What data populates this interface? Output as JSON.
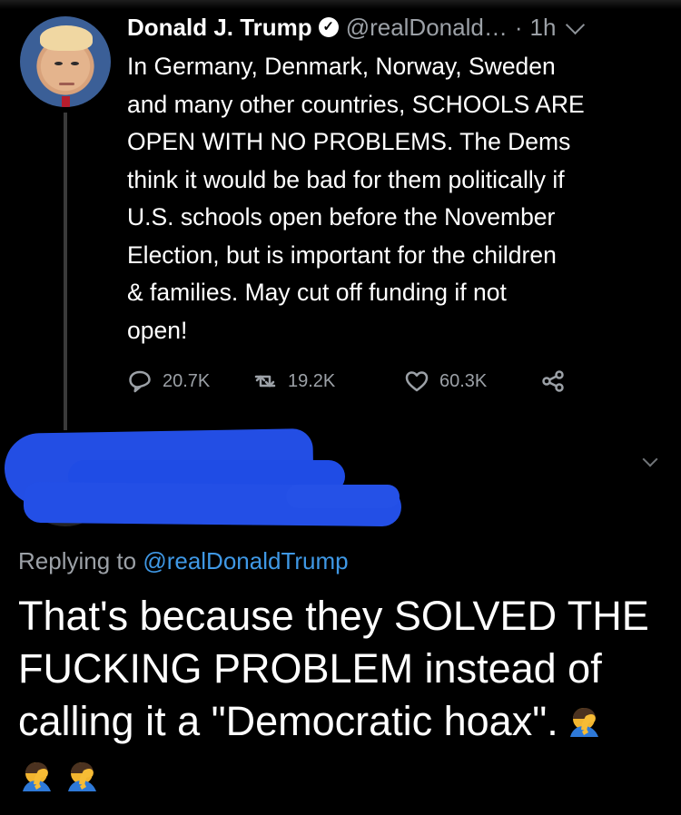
{
  "parent_tweet": {
    "display_name": "Donald J. Trump",
    "verified_mark": "✓",
    "handle": "@realDonald…",
    "separator": "·",
    "time": "1h",
    "body": "In Germany, Denmark, Norway,  Sweden\nand many other countries, SCHOOLS ARE\nOPEN WITH NO PROBLEMS. The Dems\nthink it would be bad for them politically if\nU.S. schools open before the November\nElection, but is important for the children\n& families. May cut off funding if not\nopen!",
    "actions": {
      "replies": "20.7K",
      "retweets": "19.2K",
      "likes": "60.3K"
    }
  },
  "reply": {
    "replying_prefix": "Replying to ",
    "replying_handle": "@realDonaldTrump",
    "body": "That's because they SOLVED THE FUCKING PROBLEM instead of calling it a \"Democratic hoax\".",
    "emoji_name": "person-facepalming",
    "emoji_count": 3
  },
  "colors": {
    "background": "#000000",
    "secondary_text": "#9ca1a7",
    "link": "#3f98e5",
    "redaction": "#234ee4"
  },
  "icons": {
    "reply": "speech-bubble-icon",
    "retweet": "retweet-icon",
    "like": "heart-icon",
    "share": "share-icon",
    "verified": "verified-badge-icon",
    "menu": "chevron-down-icon"
  }
}
